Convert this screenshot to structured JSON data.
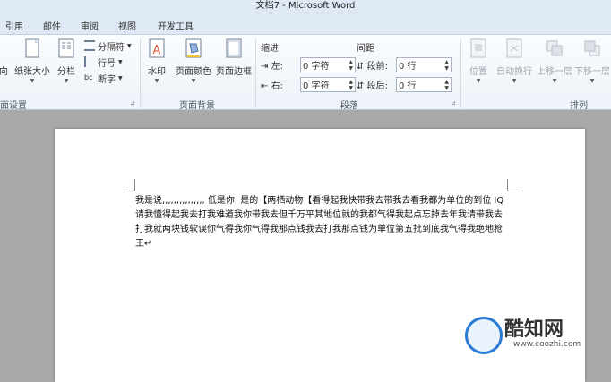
{
  "window": {
    "title": "文档7 - Microsoft Word"
  },
  "tabs": [
    "引用",
    "邮件",
    "审阅",
    "视图",
    "开发工具"
  ],
  "page_setup": {
    "partial_label": "向",
    "paper_size": "纸张大小",
    "columns": "分栏",
    "breaks": "分隔符",
    "line_numbers": "行号",
    "hyphenation": "断字",
    "group_label": "面设置"
  },
  "page_background": {
    "watermark": "水印",
    "page_color": "页面颜色",
    "page_borders": "页面边框",
    "group_label": "页面背景"
  },
  "paragraph": {
    "indent_title": "缩进",
    "spacing_title": "间距",
    "indent_left_label": "左:",
    "indent_left_value": "0 字符",
    "indent_right_label": "右:",
    "indent_right_value": "0 字符",
    "spacing_before_label": "段前:",
    "spacing_before_value": "0 行",
    "spacing_after_label": "段后:",
    "spacing_after_value": "0 行",
    "group_label": "段落"
  },
  "arrange": {
    "position": "位置",
    "wrap_text": "自动换行",
    "bring_forward": "上移一层",
    "send_backward": "下移一层",
    "group_label": "排列"
  },
  "document": {
    "text": "我是说,,,,,,,,,,,,,,, 低是你  是的【两栖动物【看得起我快带我去带我去看我都为单位的到位 IQ 请我懂得起我去打我难道我你带我去但千万平其地位就的我都气得我起点忘掉去年我请带我去打我就两块钱软误你气得我你气得我那点钱我去打我那点钱为单位第五批到底我气得我绝地枪王↵"
  },
  "watermark": {
    "title": "酷知网",
    "url": "www.coozhi.com"
  },
  "colors": {
    "ribbon_bg": "#eef3f9",
    "tab_bar_bg": "#dfe9f5",
    "workspace_bg": "#a9a9a9",
    "watermark_blue": "#2a7bd4"
  }
}
